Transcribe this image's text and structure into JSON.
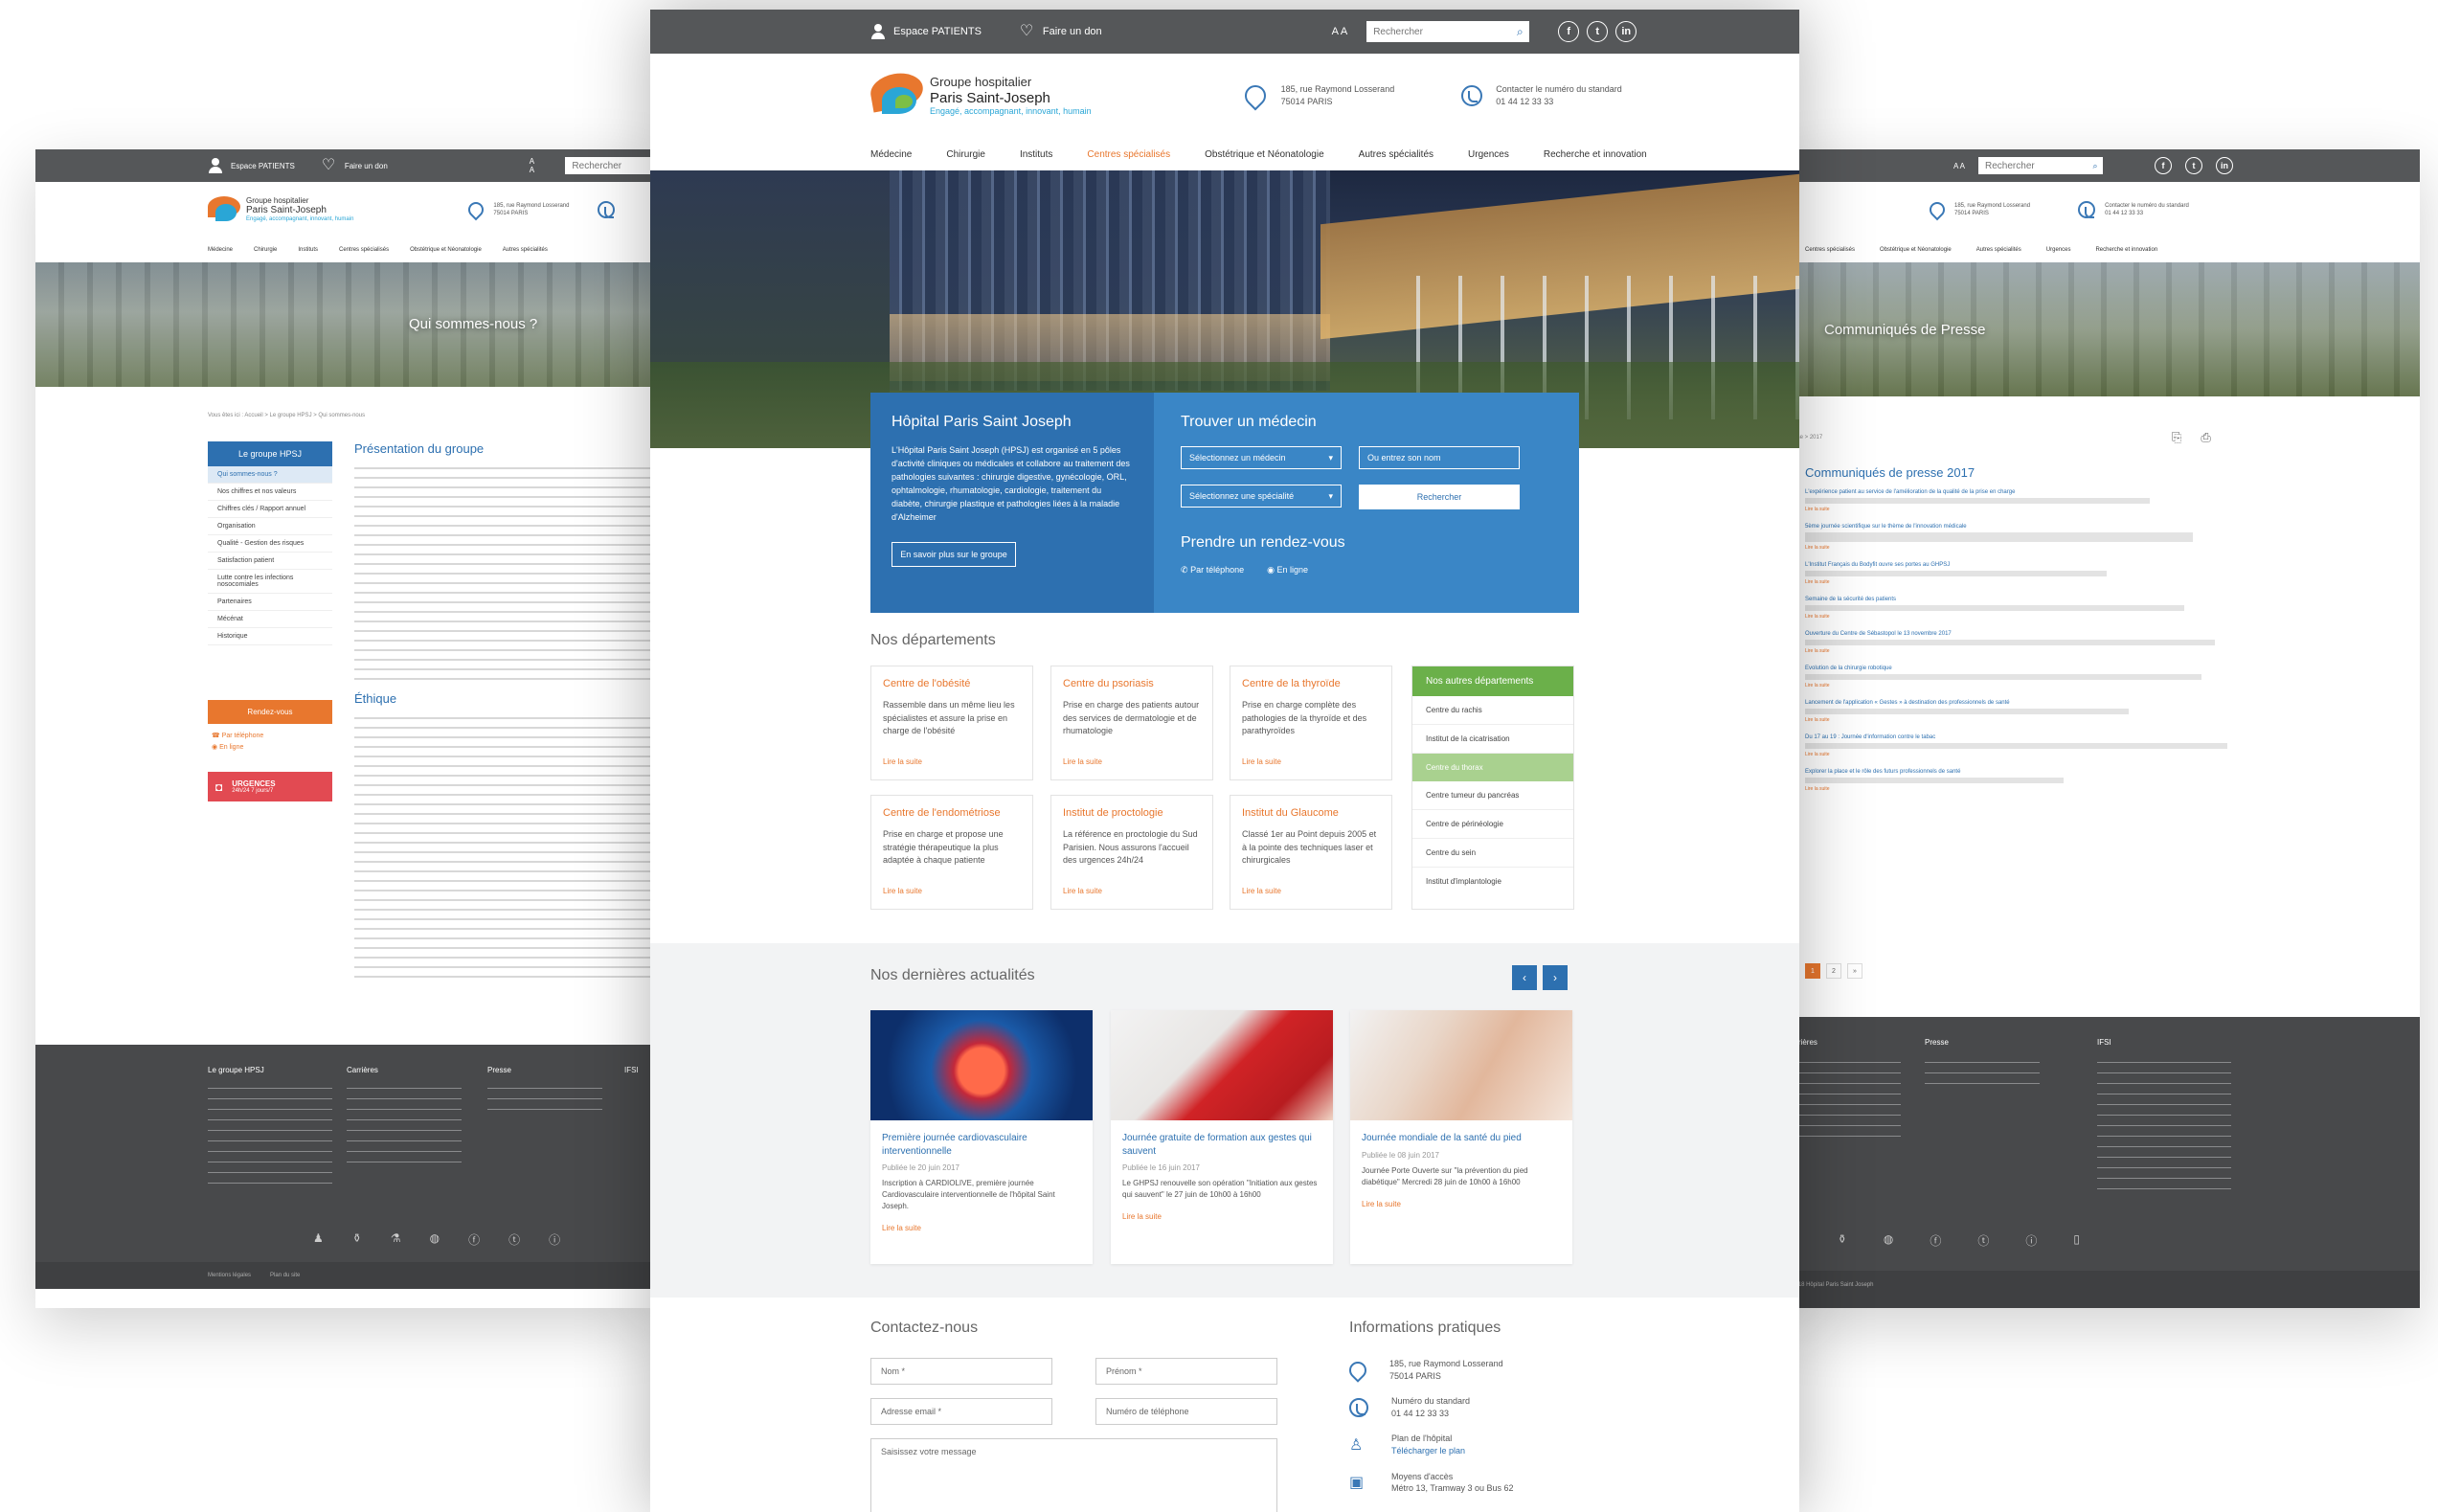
{
  "topbar": {
    "espace_patients": "Espace PATIENTS",
    "faire_un_don": "Faire un don",
    "font_size": "A A",
    "search_placeholder": "Rechercher"
  },
  "logo": {
    "line1": "Groupe hospitalier",
    "line2": "Paris Saint-Joseph",
    "tagline": "Engagé, accompagnant, innovant, humain"
  },
  "header": {
    "address_line1": "185, rue Raymond Losserand",
    "address_line2": "75014 PARIS",
    "phone_label": "Contacter le numéro du standard",
    "phone_number": "01 44 12 33 33"
  },
  "nav": {
    "items": [
      "Médecine",
      "Chirurgie",
      "Instituts",
      "Centres spécialisés",
      "Obstétrique et Néonatologie",
      "Autres spécialités",
      "Urgences",
      "Recherche et innovation"
    ],
    "active_index": 3
  },
  "main": {
    "hospital_box": {
      "title": "Hôpital Paris Saint Joseph",
      "text": "L'Hôpital Paris Saint Joseph (HPSJ) est organisé en 5 pôles d'activité cliniques ou médicales et collabore au traitement des pathologies suivantes : chirurgie digestive, gynécologie, ORL, ophtalmologie, rhumatologie, cardiologie, traitement du diabète, chirurgie plastique et pathologies liées à la maladie d'Alzheimer",
      "button": "En savoir plus sur le groupe"
    },
    "doctor_box": {
      "title": "Trouver un médecin",
      "select_doctor": "Sélectionnez un médecin",
      "select_specialty": "Sélectionnez une spécialité",
      "name_placeholder": "Ou entrez son nom",
      "search_button": "Rechercher",
      "rdv_title": "Prendre un rendez-vous",
      "by_phone": "Par téléphone",
      "online": "En ligne"
    },
    "departments": {
      "title": "Nos départements",
      "cards": [
        {
          "title": "Centre de l'obésité",
          "text": "Rassemble dans un même lieu les spécialistes et assure la prise en charge de l'obésité",
          "more": "Lire la suite"
        },
        {
          "title": "Centre du psoriasis",
          "text": "Prise en charge des patients autour des services de dermatologie et de rhumatologie",
          "more": "Lire la suite"
        },
        {
          "title": "Centre de la thyroïde",
          "text": "Prise en charge complète des pathologies de la thyroïde et des parathyroïdes",
          "more": "Lire la suite"
        },
        {
          "title": "Centre de l'endométriose",
          "text": "Prise en charge et propose une stratégie thérapeutique la plus adaptée à chaque patiente",
          "more": "Lire la suite"
        },
        {
          "title": "Institut de proctologie",
          "text": "La référence en proctologie du Sud Parisien. Nous assurons l'accueil des urgences 24h/24",
          "more": "Lire la suite"
        },
        {
          "title": "Institut du Glaucome",
          "text": "Classé 1er au Point depuis 2005 et à la pointe des techniques laser et chirurgicales",
          "more": "Lire la suite"
        }
      ],
      "other": {
        "title": "Nos autres départements",
        "items": [
          "Centre du rachis",
          "Institut de la cicatrisation",
          "Centre du thorax",
          "Centre tumeur du pancréas",
          "Centre de périnéologie",
          "Centre du sein",
          "Institut d'implantologie"
        ]
      }
    },
    "news": {
      "title": "Nos dernières actualités",
      "cards": [
        {
          "title": "Première journée cardiovasculaire interventionnelle",
          "date": "Publiée le 20 juin 2017",
          "text": "Inscription à CARDIOLIVE, première journée Cardiovasculaire interventionnelle de l'hôpital Saint Joseph.",
          "more": "Lire la suite"
        },
        {
          "title": "Journée gratuite de formation aux gestes qui sauvent",
          "date": "Publiée le 16 juin 2017",
          "text": "Le GHPSJ renouvelle son opération \"Initiation aux gestes qui sauvent\" le 27 juin de 10h00 à 16h00",
          "more": "Lire la suite"
        },
        {
          "title": "Journée mondiale de la santé du pied",
          "date": "Publiée le 08 juin 2017",
          "text": "Journée Porte Ouverte sur \"la prévention du pied diabétique\" Mercredi 28 juin de 10h00 à 16h00",
          "more": "Lire la suite"
        }
      ]
    },
    "contact": {
      "title": "Contactez-nous",
      "nom": "Nom *",
      "prenom": "Prénom *",
      "email": "Adresse email *",
      "phone": "Numéro de téléphone",
      "message": "Saisissez votre message"
    },
    "infos": {
      "title": "Informations pratiques",
      "address_line1": "185, rue Raymond Losserand",
      "address_line2": "75014 PARIS",
      "std_label": "Numéro du standard",
      "std_number": "01 44 12 33 33",
      "plan_label": "Plan de l'hôpital",
      "plan_link": "Télécharger le plan",
      "access_label": "Moyens d'accès",
      "access_text": "Métro 13, Tramway 3 ou Bus 62"
    }
  },
  "left": {
    "hero_title": "Qui sommes-nous ?",
    "breadcrumb": "Vous êtes ici : Accueil > Le groupe HPSJ > Qui sommes-nous",
    "menu_title": "Le groupe HPSJ",
    "menu_items": [
      "Qui sommes-nous ?",
      "Nos chiffres et nos valeurs",
      "Chiffres clés / Rapport annuel",
      "Organisation",
      "Qualité - Gestion des risques",
      "Satisfaction patient",
      "Lutte contre les infections nosocomiales",
      "Partenaires",
      "Mécénat",
      "Historique"
    ],
    "rdv_button": "Rendez-vous",
    "rdv_phone": "Par téléphone",
    "rdv_online": "En ligne",
    "urgences_title": "URGENCES",
    "urgences_sub": "24h/24 7 jours/7",
    "section1_title": "Présentation du groupe",
    "section2_title": "Éthique",
    "footer_cols": [
      "Le groupe HPSJ",
      "Carrières",
      "Presse",
      "IFSI"
    ],
    "bottom_links": [
      "Mentions légales",
      "Plan du site"
    ]
  },
  "right": {
    "hero_title": "Communiqués de Presse",
    "breadcrumb": "presse > 2017",
    "section_title": "Communiqués de presse 2017",
    "items": [
      "L'expérience patient au service de l'amélioration de la qualité de la prise en charge",
      "5ème journée scientifique sur le thème de l'innovation médicale",
      "L'Institut Français du Bodyfit ouvre ses portes au GHPSJ",
      "Semaine de la sécurité des patients",
      "Ouverture du Centre de Sébastopol le 13 novembre 2017",
      "Evolution de la chirurgie robotique",
      "Lancement de l'application « Gestes » à destination des professionnels de santé",
      "Du 17 au 19 : Journée d'information contre le tabac",
      "Explorer la place et le rôle des futurs professionnels de santé"
    ],
    "read_more": "Lire la suite",
    "pages": [
      "1",
      "2",
      "»"
    ],
    "footer_cols": [
      "Carrières",
      "Presse",
      "IFSI"
    ],
    "copyright": "© 2018 Hôpital Paris Saint Joseph"
  },
  "colors": {
    "topbar": "#555759",
    "blue": "#2d70b0",
    "blue_light": "#3a86c6",
    "orange": "#e8772e",
    "green": "#6bb04a",
    "red": "#e24a52",
    "footer": "#48494b"
  }
}
